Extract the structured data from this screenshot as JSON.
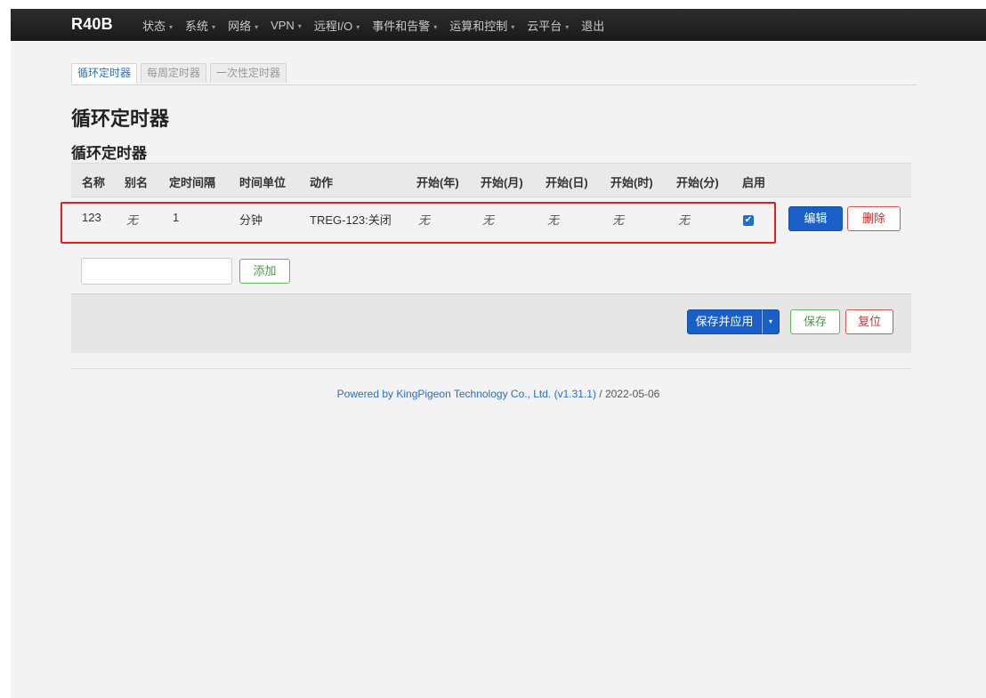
{
  "nav": {
    "brand": "R40B",
    "menu": [
      {
        "label": "状态",
        "has_caret": true
      },
      {
        "label": "系统",
        "has_caret": true
      },
      {
        "label": "网络",
        "has_caret": true
      },
      {
        "label": "VPN",
        "has_caret": true
      },
      {
        "label": "远程I/O",
        "has_caret": true
      },
      {
        "label": "事件和告警",
        "has_caret": true
      },
      {
        "label": "运算和控制",
        "has_caret": true
      },
      {
        "label": "云平台",
        "has_caret": true
      },
      {
        "label": "退出",
        "has_caret": false
      }
    ],
    "caret_glyph": "▾"
  },
  "tabs": [
    {
      "label": "循环定时器",
      "active": true
    },
    {
      "label": "每周定时器",
      "active": false
    },
    {
      "label": "一次性定时器",
      "active": false
    }
  ],
  "page": {
    "title": "循环定时器",
    "section_title": "循环定时器"
  },
  "table": {
    "headers": [
      "名称",
      "别名",
      "定时间隔",
      "时间单位",
      "动作",
      "开始(年)",
      "开始(月)",
      "开始(日)",
      "开始(时)",
      "开始(分)",
      "启用"
    ],
    "rows": [
      {
        "name": "123",
        "alias": "无",
        "interval": "1",
        "unit": "分钟",
        "action": "TREG-123:关闭",
        "start_year": "无",
        "start_month": "无",
        "start_day": "无",
        "start_hour": "无",
        "start_minute": "无",
        "enabled": true,
        "check_glyph": "✔",
        "edit_label": "编辑",
        "delete_label": "删除"
      }
    ]
  },
  "add": {
    "input_value": "",
    "button_label": "添加"
  },
  "actions": {
    "save_apply_label": "保存并应用",
    "dropdown_glyph": "▾",
    "save_label": "保存",
    "reset_label": "复位"
  },
  "footer": {
    "link_text": "Powered by KingPigeon Technology Co., Ltd. (v1.31.1)",
    "suffix": " / 2022-05-06"
  },
  "colors": {
    "navbar": "#1b1b1b",
    "primary": "#1a5fc8",
    "danger": "#d9534f",
    "success": "#5cb85c",
    "highlight": "#e02020"
  }
}
